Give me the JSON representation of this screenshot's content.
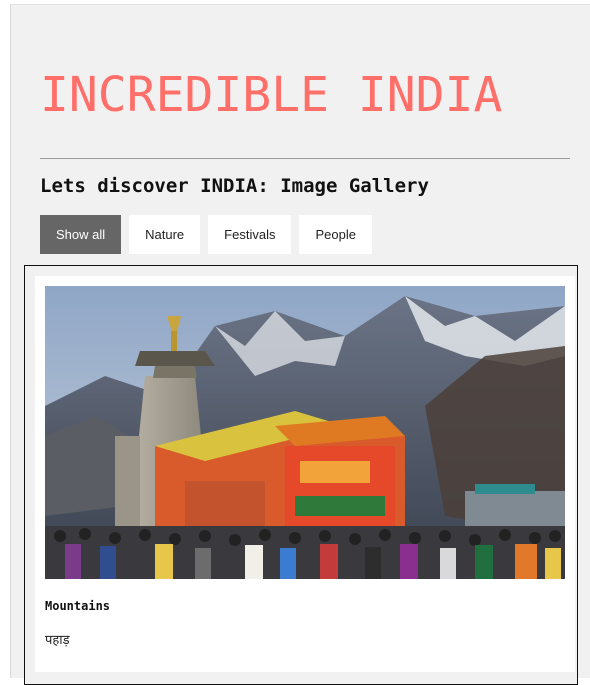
{
  "header": {
    "title": "INCREDIBLE INDIA",
    "subtitle": "Lets discover INDIA: Image Gallery"
  },
  "filters": {
    "items": [
      {
        "label": "Show all",
        "active": true
      },
      {
        "label": "Nature",
        "active": false
      },
      {
        "label": "Festivals",
        "active": false
      },
      {
        "label": "People",
        "active": false
      }
    ]
  },
  "gallery": {
    "items": [
      {
        "title": "Mountains",
        "description": "पहाड़",
        "image_icon": "temple-mountain-photo"
      }
    ]
  },
  "colors": {
    "title": "#ff6f69",
    "active_button": "#666666",
    "page_background": "#f1f1f1"
  }
}
